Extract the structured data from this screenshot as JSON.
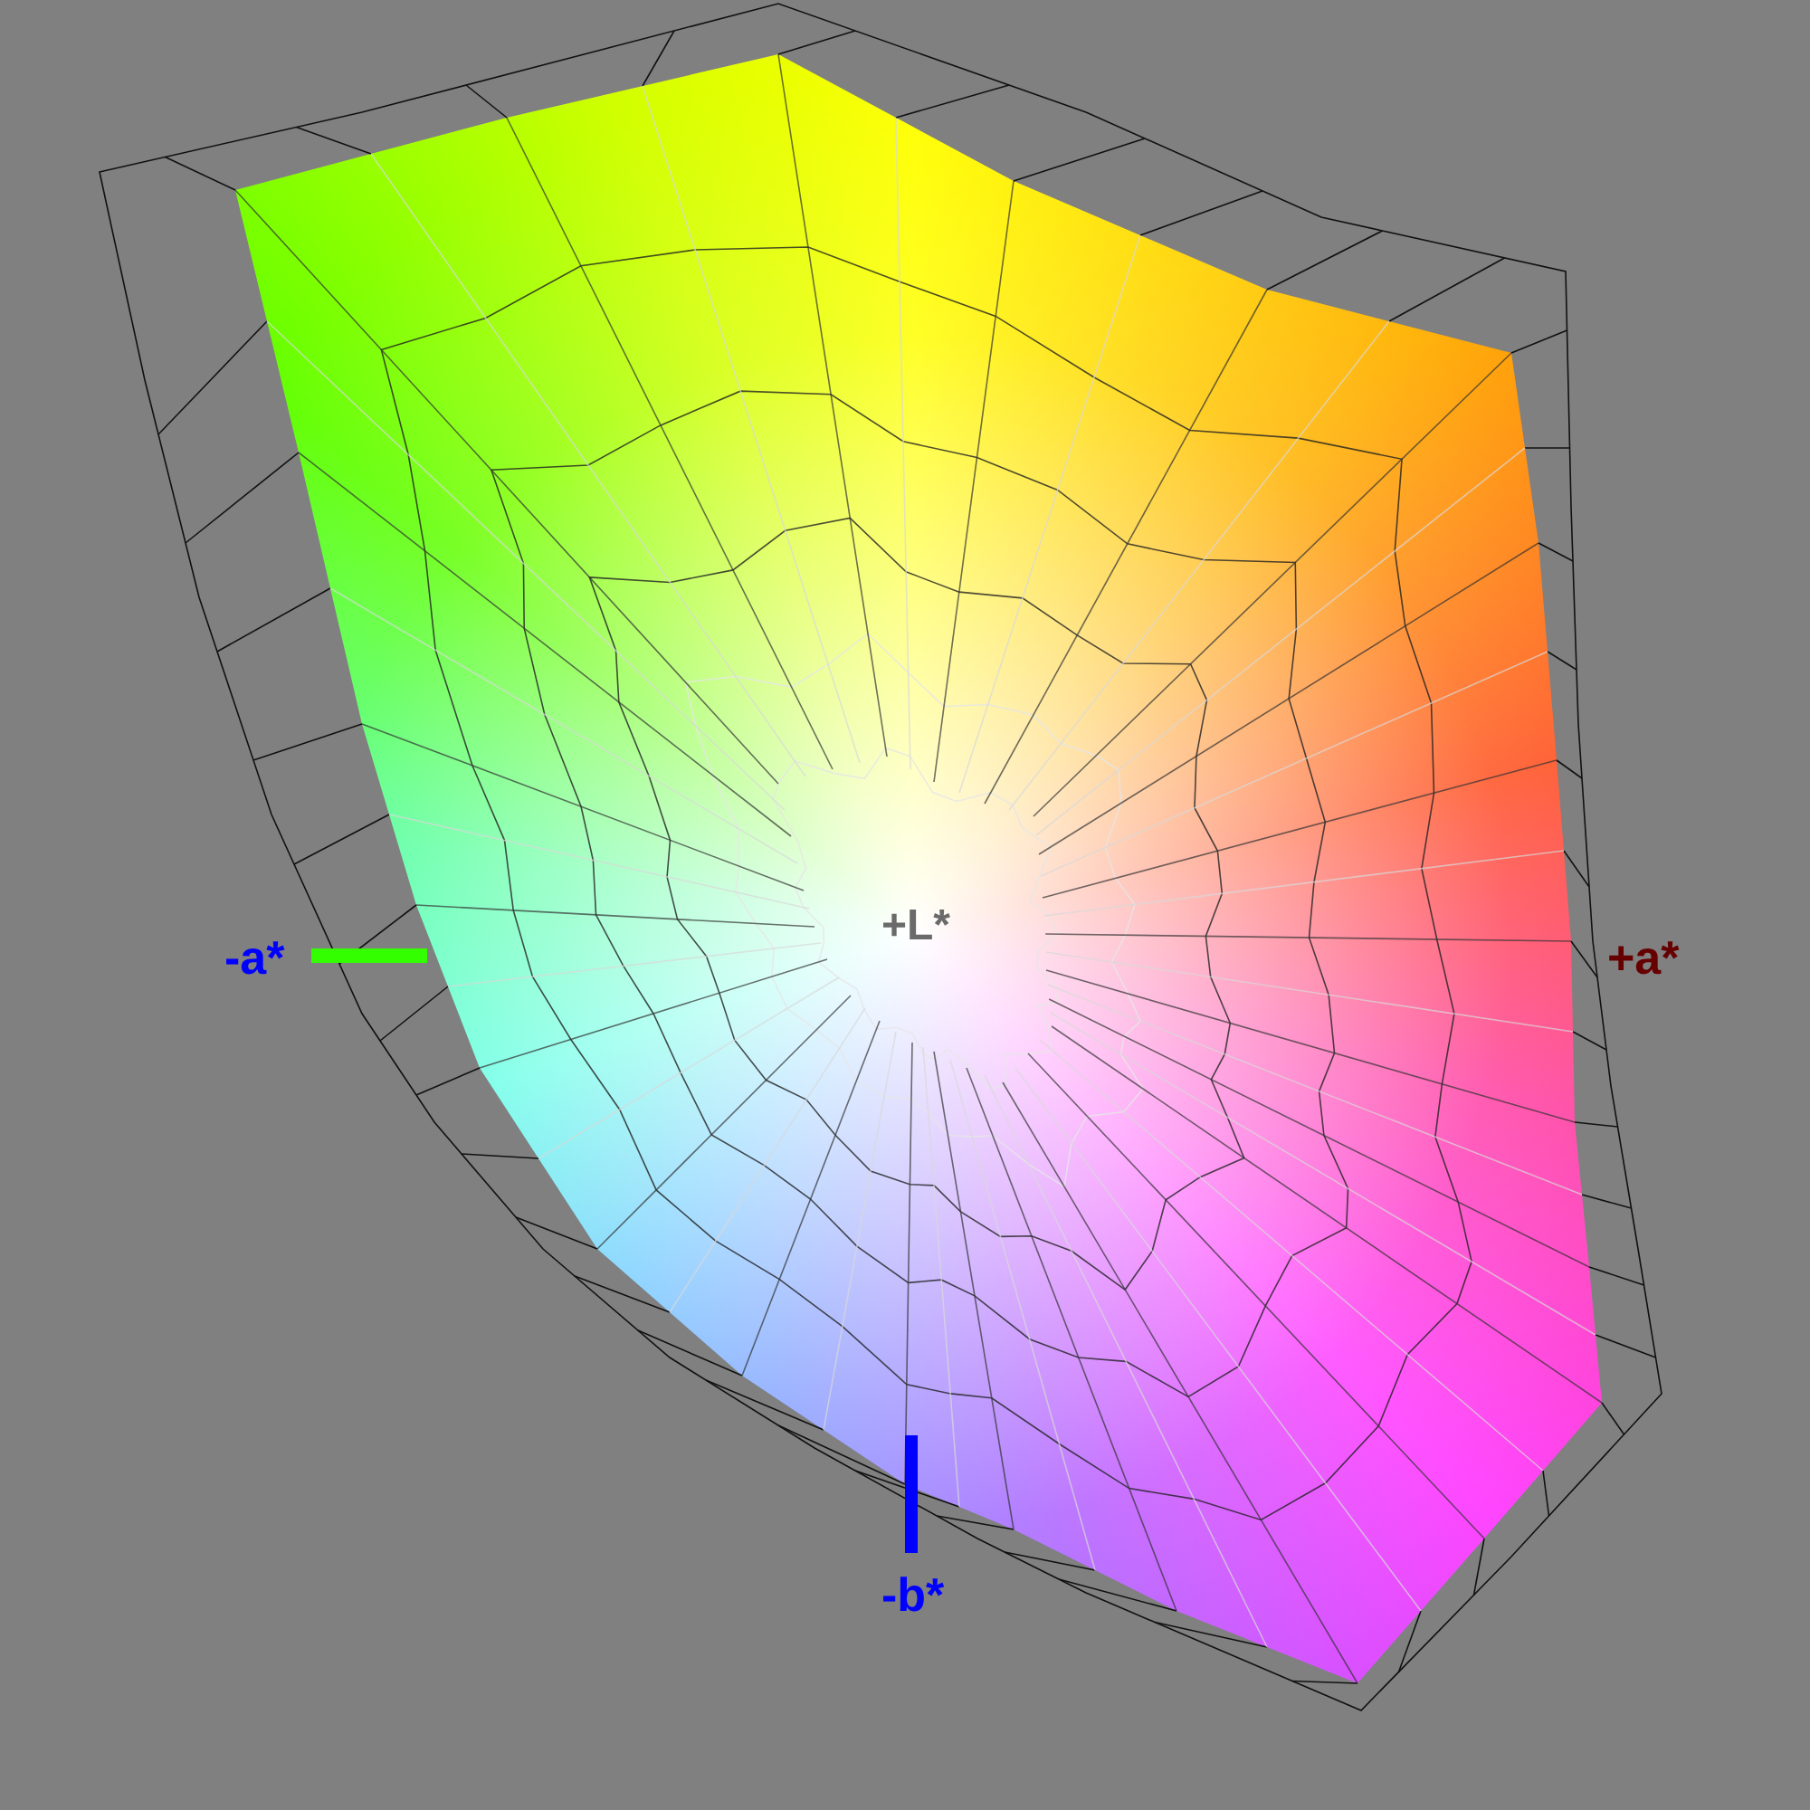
{
  "axes": [
    {
      "kind": "a_neg",
      "label": "-a*"
    },
    {
      "kind": "a_pos",
      "label": "+a*"
    },
    {
      "kind": "b_neg",
      "label": "-b*"
    },
    {
      "kind": "l_pos",
      "label": "+L*"
    }
  ]
}
